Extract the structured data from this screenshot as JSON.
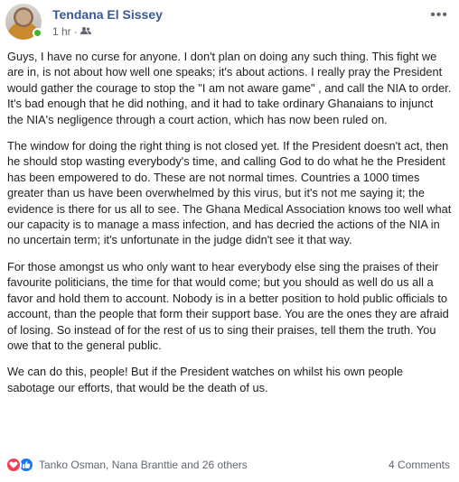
{
  "post": {
    "author": "Tendana El Sissey",
    "time": "1 hr",
    "separator": "·",
    "audience_icon": "friends-icon",
    "menu_icon": "more-icon",
    "menu_glyph": "•••",
    "paragraphs": [
      "Guys, I have no curse for anyone. I don't plan on doing any such thing. This fight we are in, is not about how well one speaks; it's about actions. I really pray the President would gather the courage to stop the \"I am not aware game\" , and call the NIA to order. It's bad enough that he did nothing, and it had to take ordinary Ghanaians to injunct the NIA's negligence through a court action, which has now been ruled on.",
      "The window for doing the right thing is not closed yet. If the President doesn't act, then he should stop wasting everybody's time, and calling God to do what he the President has been empowered to do. These are not normal times. Countries a 1000 times greater than us have been overwhelmed by this virus, but it's not me saying it; the evidence is there for us all to see. The Ghana Medical Association knows too well what our capacity is to manage a mass infection, and has decried the actions of the NIA in no uncertain term; it's unfortunate in the judge didn't see it that way.",
      "For those amongst us who only want to hear everybody else sing the praises of their favourite politicians, the time for that would come; but you should as well do us all a favor and hold them to account. Nobody is in a better position to hold public officials to account, than the people that form their support base. You are the ones they are afraid of losing. So instead of for the rest of us to sing their praises, tell them the truth. You owe that to the general public.",
      "We can do this, people! But if the President watches on whilst his own people sabotage our efforts, that would be the death of us."
    ]
  },
  "footer": {
    "reactions_text": "Tanko Osman, Nana Branttie and 26 others",
    "comments_text": "4 Comments",
    "reaction_icons": [
      "love-reaction-icon",
      "like-reaction-icon"
    ],
    "colors": {
      "love": "#f33e58",
      "like": "#1877f2",
      "name": "#385898",
      "online": "#42b72a"
    }
  }
}
